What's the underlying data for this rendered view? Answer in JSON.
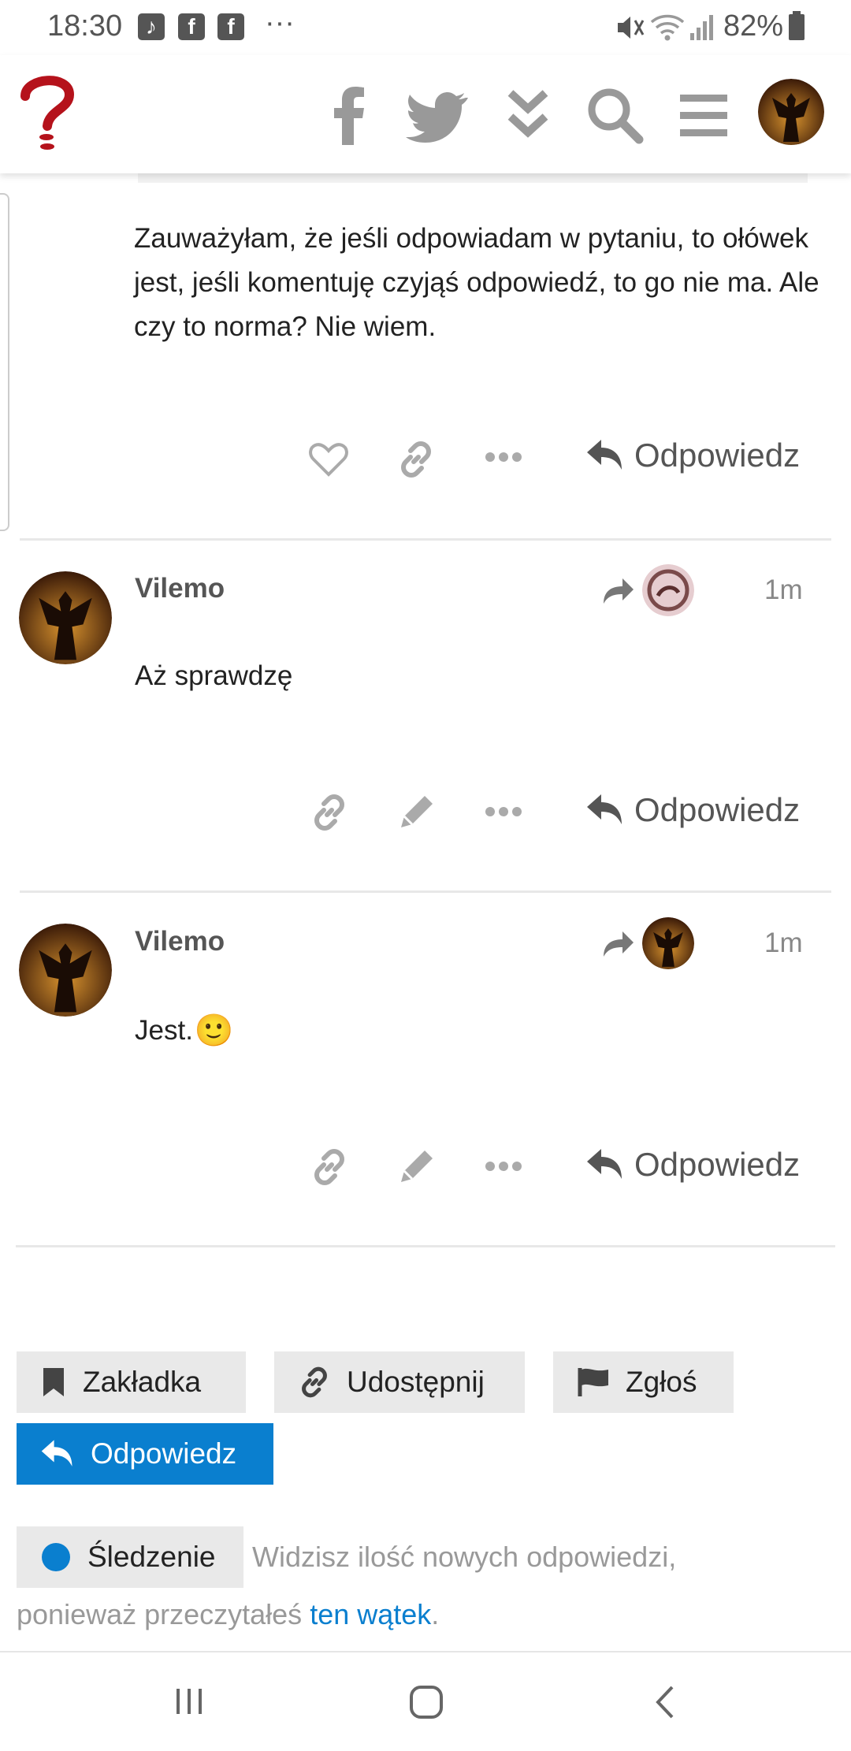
{
  "status_bar": {
    "time": "18:30",
    "battery": "82%",
    "notif_icons": [
      "music-note",
      "facebook",
      "facebook"
    ],
    "more": "···"
  },
  "header": {
    "logo_glyph": "?"
  },
  "post0": {
    "body": "Zauważyłam, że jeśli odpowiadam w pytaniu, to ołówek jest, jeśli komentuję czyjąś odpowiedź, to go nie ma. Ale czy to norma? Nie wiem.",
    "reply_label": "Odpowiedz"
  },
  "post1": {
    "username": "Vilemo",
    "time": "1m",
    "body": "Aż sprawdzę",
    "reply_label": "Odpowiedz"
  },
  "post2": {
    "username": "Vilemo",
    "time": "1m",
    "body": "Jest.",
    "emoji": "🙂",
    "reply_label": "Odpowiedz"
  },
  "actions": {
    "bookmark": "Zakładka",
    "share": "Udostępnij",
    "flag": "Zgłoś",
    "reply": "Odpowiedz"
  },
  "tracking": {
    "button": "Śledzenie",
    "text_before": "Widzisz ilość nowych odpowiedzi,",
    "text_line2": "ponieważ przeczytałeś",
    "link": "ten wątek",
    "period": "."
  },
  "colors": {
    "accent": "#0a7fcf",
    "logo_red": "#b5121b"
  }
}
